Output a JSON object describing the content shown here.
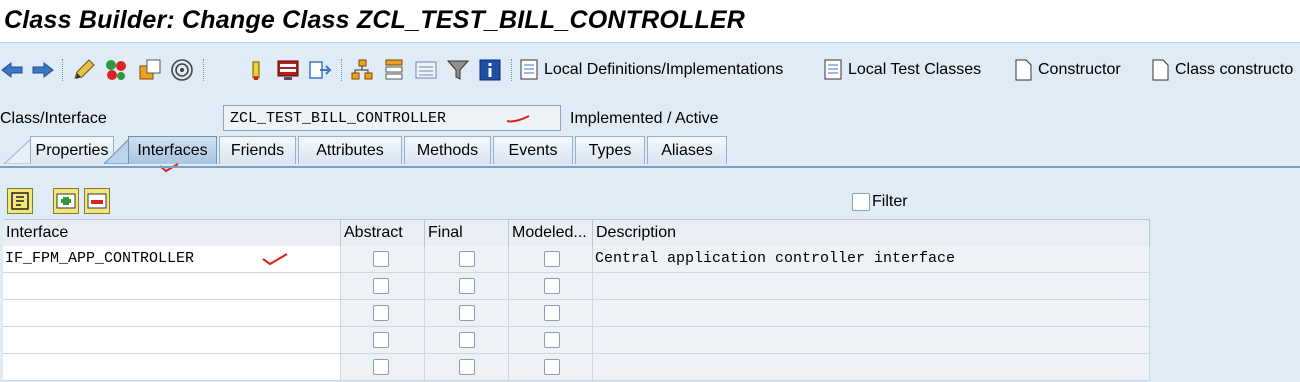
{
  "window": {
    "title": "Class Builder: Change Class ZCL_TEST_BILL_CONTROLLER"
  },
  "toolbar": {
    "icons": [
      "back-arrow-icon",
      "forward-arrow-icon",
      "edit-pencil-icon",
      "activate-icon",
      "object-list-icon",
      "where-used-icon",
      "insert-icon",
      "display-object-icon",
      "navigate-icon",
      "hierarchy-icon",
      "stack-icon",
      "list-icon",
      "filter-icon",
      "info-icon"
    ],
    "buttons": {
      "local_definitions": "Local Definitions/Implementations",
      "local_test_classes": "Local Test Classes",
      "constructor": "Constructor",
      "class_constructor": "Class constructo"
    }
  },
  "class_row": {
    "label": "Class/Interface",
    "value": "ZCL_TEST_BILL_CONTROLLER",
    "status": "Implemented / Active"
  },
  "tabs": [
    "Properties",
    "Interfaces",
    "Friends",
    "Attributes",
    "Methods",
    "Events",
    "Types",
    "Aliases"
  ],
  "active_tab": "Interfaces",
  "filter_label": "Filter",
  "table": {
    "columns": [
      "Interface",
      "Abstract",
      "Final",
      "Modeled...",
      "Description"
    ],
    "rows": [
      {
        "interface": "IF_FPM_APP_CONTROLLER",
        "description": "Central application controller interface"
      },
      {
        "interface": "",
        "description": ""
      },
      {
        "interface": "",
        "description": ""
      },
      {
        "interface": "",
        "description": ""
      },
      {
        "interface": "",
        "description": ""
      }
    ]
  },
  "colors": {
    "accent": "#dfebf5",
    "annotation": "#e0201a"
  }
}
